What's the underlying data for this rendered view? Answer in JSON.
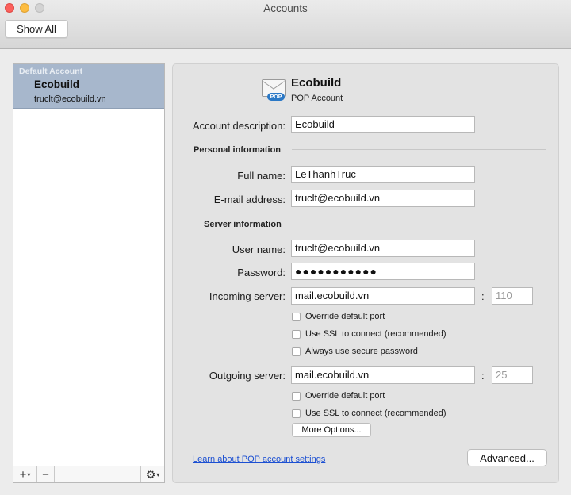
{
  "window": {
    "title": "Accounts"
  },
  "toolbar": {
    "show_all_label": "Show All"
  },
  "sidebar": {
    "accounts": [
      {
        "group": "Default Account",
        "name": "Ecobuild",
        "email": "truclt@ecobuild.vn"
      }
    ],
    "add_label": "+",
    "remove_label": "−",
    "gear_label": "⚙"
  },
  "account": {
    "name": "Ecobuild",
    "type": "POP Account",
    "icon": "mail-envelope-pop-icon",
    "badge": "POP"
  },
  "form": {
    "account_description": {
      "label": "Account description:",
      "value": "Ecobuild"
    },
    "personal_section": "Personal information",
    "full_name": {
      "label": "Full name:",
      "value": "LeThanhTruc"
    },
    "email": {
      "label": "E-mail address:",
      "value": "truclt@ecobuild.vn"
    },
    "server_section": "Server information",
    "user_name": {
      "label": "User name:",
      "value": "truclt@ecobuild.vn"
    },
    "password": {
      "label": "Password:",
      "value": "●●●●●●●●●●●"
    },
    "incoming": {
      "label": "Incoming server:",
      "value": "mail.ecobuild.vn",
      "port_placeholder": "110",
      "options": [
        "Override default port",
        "Use SSL to connect (recommended)",
        "Always use secure password"
      ]
    },
    "outgoing": {
      "label": "Outgoing server:",
      "value": "mail.ecobuild.vn",
      "port_placeholder": "25",
      "options": [
        "Override default port",
        "Use SSL to connect (recommended)"
      ]
    },
    "more_options_label": "More Options...",
    "learn_link": "Learn about POP account settings",
    "advanced_label": "Advanced..."
  },
  "colors": {
    "selected_row": "#a7b7cc",
    "link": "#1b4fd2",
    "pop_badge": "#2a78c6"
  }
}
